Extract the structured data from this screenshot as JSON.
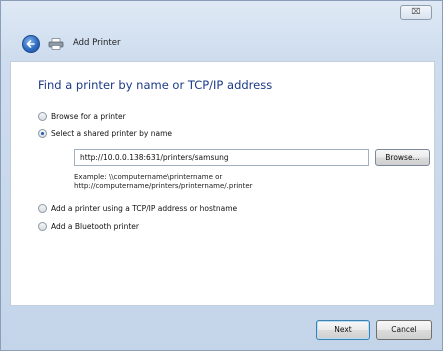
{
  "window": {
    "close_glyph": "⌧",
    "dialog_title": "Add Printer"
  },
  "heading": "Find a printer by name or TCP/IP address",
  "options": {
    "browse": "Browse for a printer",
    "shared": "Select a shared printer by name",
    "tcpip": "Add a printer using a TCP/IP address or hostname",
    "bluetooth": "Add a Bluetooth printer"
  },
  "selected_option": "shared",
  "shared_printer": {
    "value": "http://10.0.0.138:631/printers/samsung",
    "browse_label": "Browse...",
    "example_line1": "Example: \\\\computername\\printername or",
    "example_line2": "http://computername/printers/printername/.printer"
  },
  "footer": {
    "next_label": "Next",
    "cancel_label": "Cancel"
  },
  "icons": {
    "back": "back-arrow-icon",
    "printer": "printer-icon",
    "close": "close-icon"
  },
  "colors": {
    "heading": "#1c3a8a",
    "window_chrome": "#cddcee",
    "radio_selected": "#1f5fb7"
  }
}
